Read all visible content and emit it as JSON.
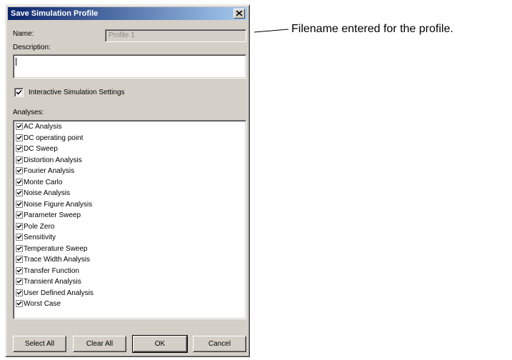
{
  "dialog": {
    "title": "Save Simulation Profile",
    "name_label": "Name:",
    "name_value": "Profile 1",
    "description_label": "Description:",
    "description_value": "",
    "interactive_checkbox_label": "Interactive Simulation Settings",
    "interactive_checked": true,
    "analyses_label": "Analyses:",
    "analyses": [
      {
        "label": "AC Analysis",
        "checked": true
      },
      {
        "label": "DC operating point",
        "checked": true
      },
      {
        "label": "DC Sweep",
        "checked": true
      },
      {
        "label": "Distortion Analysis",
        "checked": true
      },
      {
        "label": "Fourier Analysis",
        "checked": true
      },
      {
        "label": "Monte Carlo",
        "checked": true
      },
      {
        "label": "Noise Analysis",
        "checked": true
      },
      {
        "label": "Noise Figure Analysis",
        "checked": true
      },
      {
        "label": "Parameter Sweep",
        "checked": true
      },
      {
        "label": "Pole Zero",
        "checked": true
      },
      {
        "label": "Sensitivity",
        "checked": true
      },
      {
        "label": "Temperature Sweep",
        "checked": true
      },
      {
        "label": "Trace Width Analysis",
        "checked": true
      },
      {
        "label": "Transfer Function",
        "checked": true
      },
      {
        "label": "Transient Analysis",
        "checked": true
      },
      {
        "label": "User Defined Analysis",
        "checked": true
      },
      {
        "label": "Worst Case",
        "checked": true
      }
    ],
    "buttons": {
      "select_all": "Select All",
      "clear_all": "Clear All",
      "ok": "OK",
      "cancel": "Cancel"
    }
  },
  "callout": {
    "text": "Filename entered for the profile."
  },
  "colors": {
    "dialog_face": "#d4d0c8",
    "titlebar_start": "#0a246a",
    "titlebar_end": "#a6caf0"
  }
}
